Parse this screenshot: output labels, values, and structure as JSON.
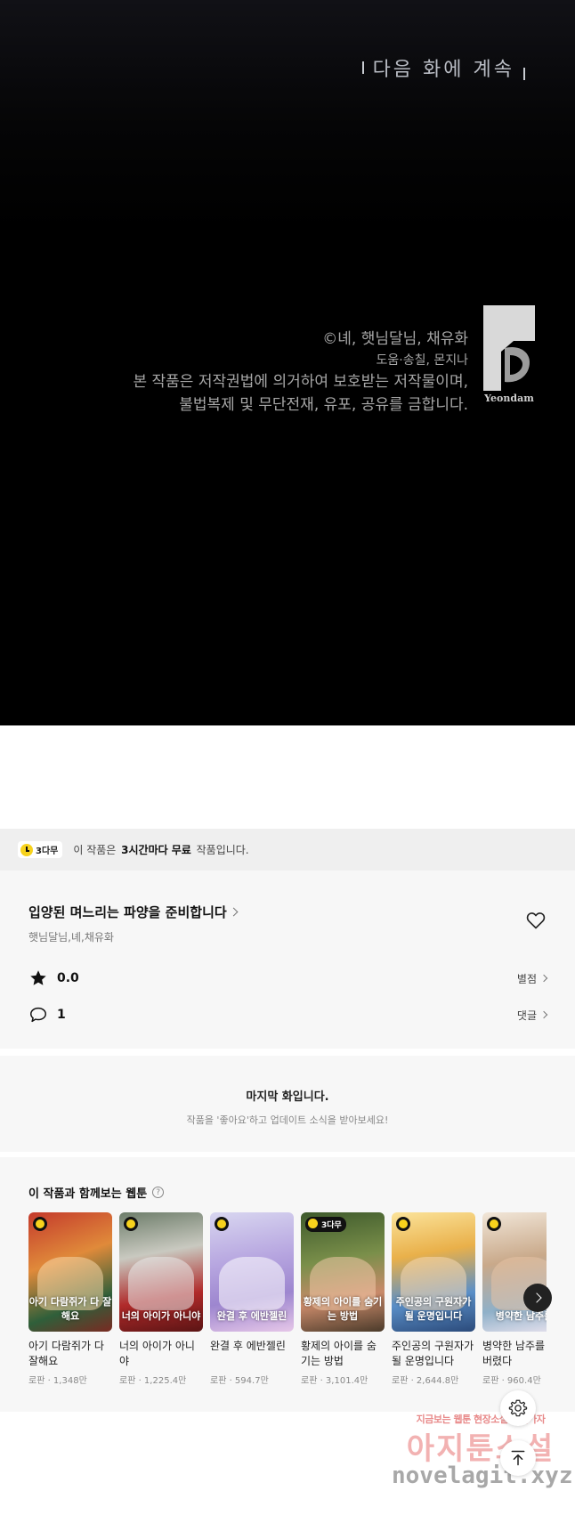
{
  "panel": {
    "next_episode": "다음 화에 계속",
    "copyright": "©녜, 햇님달님, 채유화",
    "assist": "도움·송칠, 몬지나",
    "legal_1": "본 작품은 저작권법에 의거하여 보호받는 저작물이며,",
    "legal_2": "불법복제 및 무단전재, 유포, 공유를 금합니다.",
    "logo_text": "Yeondam"
  },
  "free_banner": {
    "badge": "3다무",
    "text_pre": "이 작품은",
    "text_bold_1": "3시간마다",
    "text_bold_2": "무료",
    "text_post": "작품입니다."
  },
  "work": {
    "title": "입양된 며느리는 파양을 준비합니다",
    "authors": "햇님달님,녜,채유화",
    "rating": "0.0",
    "rating_link": "별점",
    "comments": "1",
    "comments_link": "댓글"
  },
  "last_episode": {
    "heading": "마지막 화입니다.",
    "sub": "작품을 '좋아요'하고 업데이트 소식을 받아보세요!"
  },
  "recommend": {
    "title": "이 작품과 함께보는 웹툰",
    "help": "?",
    "items": [
      {
        "title": "아기 다람쥐가 다 잘해요",
        "meta": "로판 · 1,348만",
        "cover_text": "아기 다람쥐가 다 잘해요",
        "badge": ""
      },
      {
        "title": "너의 아이가 아니야",
        "meta": "로판 · 1,225.4만",
        "cover_text": "너의 아이가 아니야",
        "badge": ""
      },
      {
        "title": "완결 후 에반젤린",
        "meta": "로판 · 594.7만",
        "cover_text": "완결 후 에반젤린",
        "badge": ""
      },
      {
        "title": "황제의 아이를 숨기는 방법",
        "meta": "로판 · 3,101.4만",
        "cover_text": "황제의 아이를 숨기는 방법",
        "badge": "3다무"
      },
      {
        "title": "주인공의 구원자가 될 운명입니다",
        "meta": "로판 · 2,644.8만",
        "cover_text": "주인공의 구원자가 될 운명입니다",
        "badge": ""
      },
      {
        "title": "병약한 남주를 셔버렸다",
        "meta": "로판 · 960.4만",
        "cover_text": "병약한 남주를",
        "badge": ""
      }
    ]
  },
  "watermark": {
    "line1": "지금보는 웹툰 현장소설 보러가자",
    "line2": "아지툰소설",
    "line3": "novelagit.xyz"
  },
  "colors": {
    "accent_yellow": "#f7d21c",
    "panel_bg": "#000000",
    "section_bg": "#f7f7f7"
  },
  "icons": [
    "clock-icon",
    "chevron-right-icon",
    "heart-icon",
    "star-icon",
    "comment-icon",
    "help-icon",
    "gear-icon",
    "arrow-up-icon"
  ]
}
